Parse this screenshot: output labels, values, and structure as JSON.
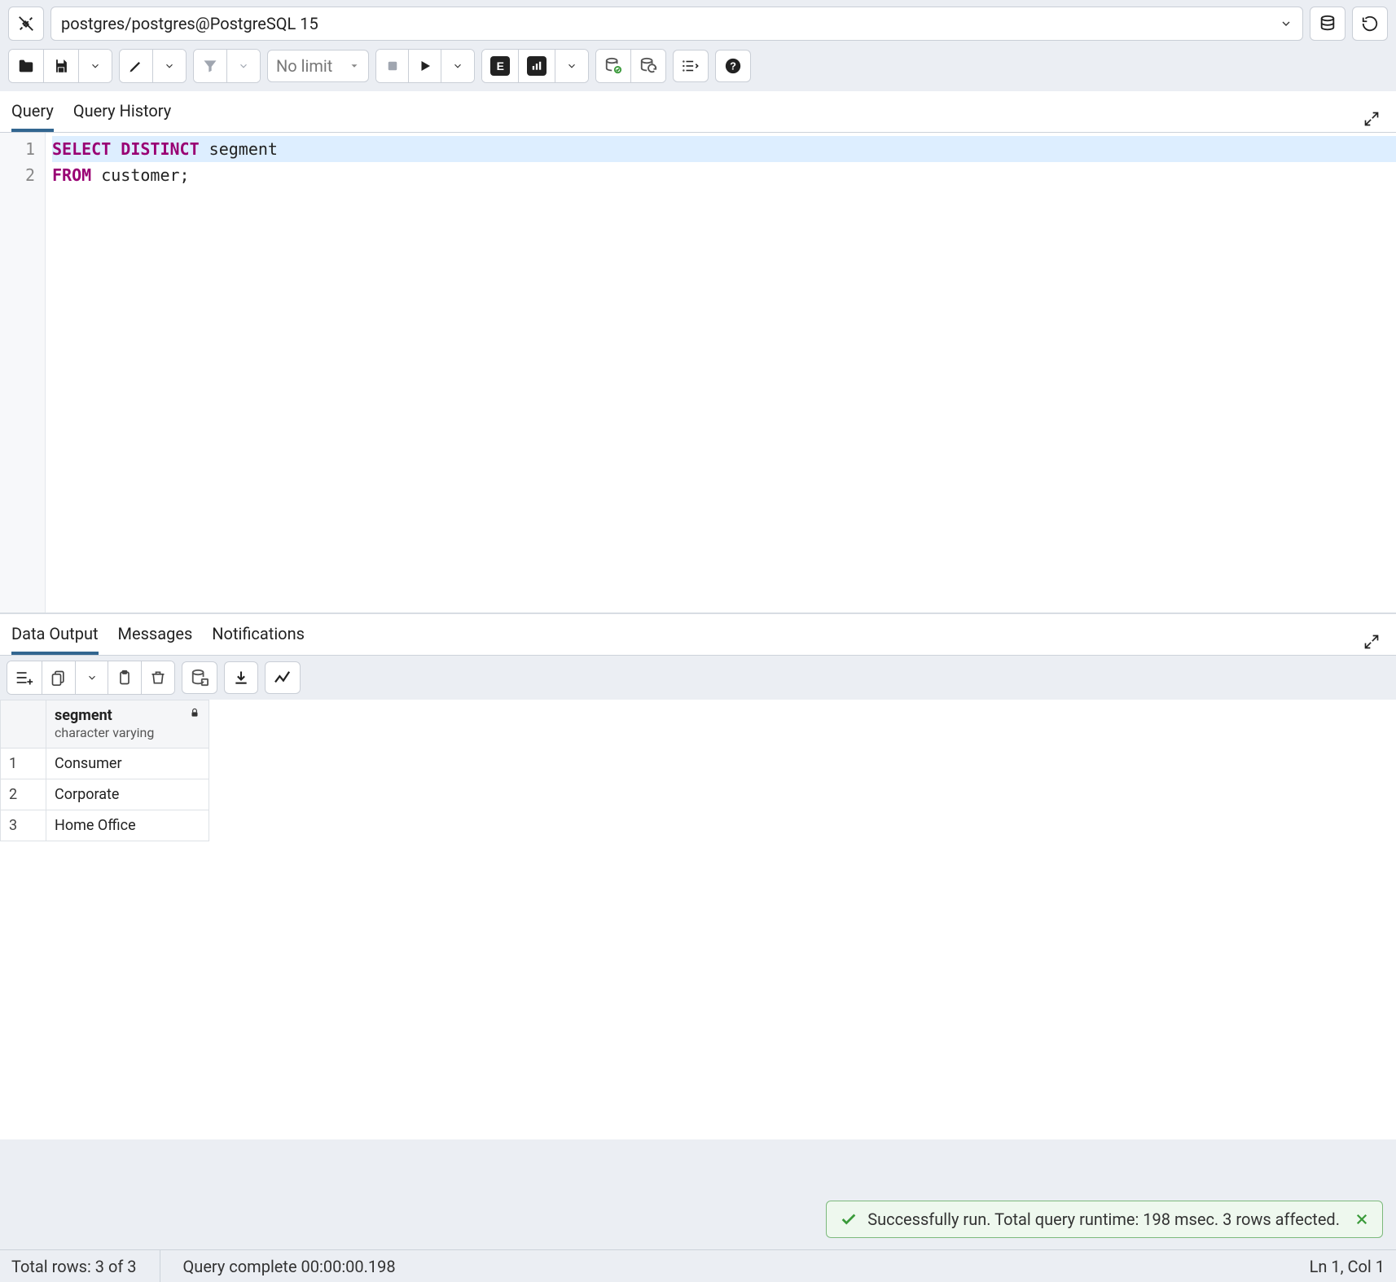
{
  "connection": {
    "label": "postgres/postgres@PostgreSQL 15"
  },
  "toolbar": {
    "limit_label": "No limit"
  },
  "editor_tabs": {
    "query": "Query",
    "history": "Query History"
  },
  "code": {
    "line1_kw1": "SELECT",
    "line1_kw2": "DISTINCT",
    "line1_ident": "segment",
    "line2_kw": "FROM",
    "line2_ident": "customer",
    "line2_semi": ";",
    "line_numbers": [
      "1",
      "2"
    ]
  },
  "output_tabs": {
    "data": "Data Output",
    "messages": "Messages",
    "notifications": "Notifications"
  },
  "result": {
    "column": {
      "name": "segment",
      "type": "character varying"
    },
    "rows": [
      {
        "n": "1",
        "v": "Consumer"
      },
      {
        "n": "2",
        "v": "Corporate"
      },
      {
        "n": "3",
        "v": "Home Office"
      }
    ]
  },
  "toast": {
    "text": "Successfully run. Total query runtime: 198 msec. 3 rows affected."
  },
  "status": {
    "rows": "Total rows: 3 of 3",
    "complete": "Query complete 00:00:00.198",
    "cursor": "Ln 1, Col 1"
  }
}
